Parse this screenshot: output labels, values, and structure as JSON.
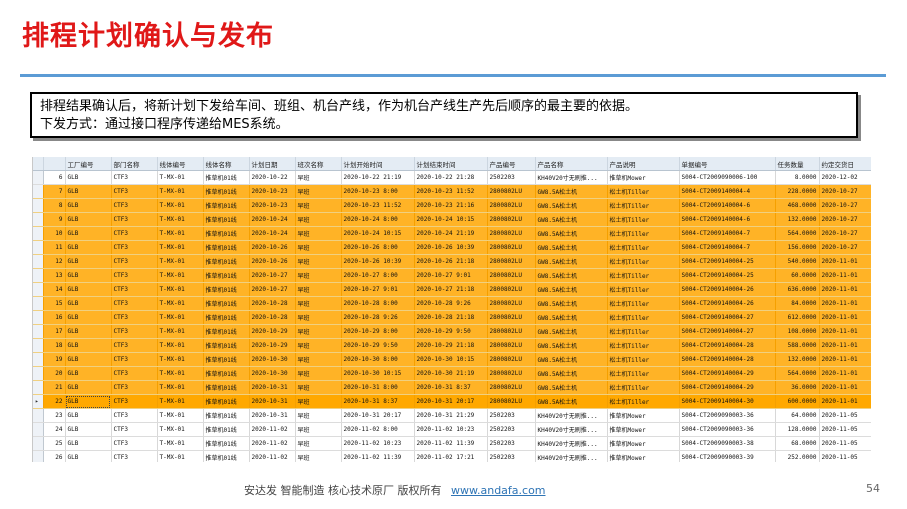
{
  "title": "排程计划确认与发布",
  "note": {
    "line1": "排程结果确认后，将新计划下发给车间、班组、机台产线，作为机台产线生产先后顺序的最主要的依据。",
    "line2": "下发方式：通过接口程序传递给MES系统。"
  },
  "grid": {
    "columns": [
      "",
      "工厂编号",
      "部门名称",
      "线体编号",
      "线体名称",
      "计划日期",
      "班次名称",
      "计划开始时间",
      "计划结束时间",
      "产品编号",
      "产品名称",
      "产品说明",
      "单据编号",
      "任务数量",
      "约定交货日"
    ],
    "current_row_marker": "▸",
    "rows": [
      {
        "n": "6",
        "f": "GLB",
        "d": "CTF3",
        "l": "T-MX-01",
        "ln": "推草机01线",
        "date": "2020-10-22",
        "shift": "早班",
        "start": "2020-10-22 21:19",
        "end": "2020-10-22 21:28",
        "pno": "2502203",
        "pname": "KH40V20寸无刷推...",
        "pdesc": "推草机Mower",
        "doc": "S004-CT2009090006-100",
        "qty": "8.0000",
        "due": "2020-12-02",
        "hl": false
      },
      {
        "n": "7",
        "f": "GLB",
        "d": "CTF3",
        "l": "T-MX-01",
        "ln": "推草机01线",
        "date": "2020-10-23",
        "shift": "早班",
        "start": "2020-10-23 8:00",
        "end": "2020-10-23 11:52",
        "pno": "2800802LU",
        "pname": "GW8.5A松土机",
        "pdesc": "松土机Tiller",
        "doc": "S004-CT2009140004-4",
        "qty": "228.0000",
        "due": "2020-10-27",
        "hl": true
      },
      {
        "n": "8",
        "f": "GLB",
        "d": "CTF3",
        "l": "T-MX-01",
        "ln": "推草机01线",
        "date": "2020-10-23",
        "shift": "早班",
        "start": "2020-10-23 11:52",
        "end": "2020-10-23 21:16",
        "pno": "2800802LU",
        "pname": "GW8.5A松土机",
        "pdesc": "松土机Tiller",
        "doc": "S004-CT2009140004-6",
        "qty": "468.0000",
        "due": "2020-10-27",
        "hl": true
      },
      {
        "n": "9",
        "f": "GLB",
        "d": "CTF3",
        "l": "T-MX-01",
        "ln": "推草机01线",
        "date": "2020-10-24",
        "shift": "早班",
        "start": "2020-10-24 8:00",
        "end": "2020-10-24 10:15",
        "pno": "2800802LU",
        "pname": "GW8.5A松土机",
        "pdesc": "松土机Tiller",
        "doc": "S004-CT2009140004-6",
        "qty": "132.0000",
        "due": "2020-10-27",
        "hl": true
      },
      {
        "n": "10",
        "f": "GLB",
        "d": "CTF3",
        "l": "T-MX-01",
        "ln": "推草机01线",
        "date": "2020-10-24",
        "shift": "早班",
        "start": "2020-10-24 10:15",
        "end": "2020-10-24 21:19",
        "pno": "2800802LU",
        "pname": "GW8.5A松土机",
        "pdesc": "松土机Tiller",
        "doc": "S004-CT2009140004-7",
        "qty": "564.0000",
        "due": "2020-10-27",
        "hl": true
      },
      {
        "n": "11",
        "f": "GLB",
        "d": "CTF3",
        "l": "T-MX-01",
        "ln": "推草机01线",
        "date": "2020-10-26",
        "shift": "早班",
        "start": "2020-10-26 8:00",
        "end": "2020-10-26 10:39",
        "pno": "2800802LU",
        "pname": "GW8.5A松土机",
        "pdesc": "松土机Tiller",
        "doc": "S004-CT2009140004-7",
        "qty": "156.0000",
        "due": "2020-10-27",
        "hl": true
      },
      {
        "n": "12",
        "f": "GLB",
        "d": "CTF3",
        "l": "T-MX-01",
        "ln": "推草机01线",
        "date": "2020-10-26",
        "shift": "早班",
        "start": "2020-10-26 10:39",
        "end": "2020-10-26 21:18",
        "pno": "2800802LU",
        "pname": "GW8.5A松土机",
        "pdesc": "松土机Tiller",
        "doc": "S004-CT2009140004-25",
        "qty": "540.0000",
        "due": "2020-11-01",
        "hl": true
      },
      {
        "n": "13",
        "f": "GLB",
        "d": "CTF3",
        "l": "T-MX-01",
        "ln": "推草机01线",
        "date": "2020-10-27",
        "shift": "早班",
        "start": "2020-10-27 8:00",
        "end": "2020-10-27 9:01",
        "pno": "2800802LU",
        "pname": "GW8.5A松土机",
        "pdesc": "松土机Tiller",
        "doc": "S004-CT2009140004-25",
        "qty": "60.0000",
        "due": "2020-11-01",
        "hl": true
      },
      {
        "n": "14",
        "f": "GLB",
        "d": "CTF3",
        "l": "T-MX-01",
        "ln": "推草机01线",
        "date": "2020-10-27",
        "shift": "早班",
        "start": "2020-10-27 9:01",
        "end": "2020-10-27 21:18",
        "pno": "2800802LU",
        "pname": "GW8.5A松土机",
        "pdesc": "松土机Tiller",
        "doc": "S004-CT2009140004-26",
        "qty": "636.0000",
        "due": "2020-11-01",
        "hl": true
      },
      {
        "n": "15",
        "f": "GLB",
        "d": "CTF3",
        "l": "T-MX-01",
        "ln": "推草机01线",
        "date": "2020-10-28",
        "shift": "早班",
        "start": "2020-10-28 8:00",
        "end": "2020-10-28 9:26",
        "pno": "2800802LU",
        "pname": "GW8.5A松土机",
        "pdesc": "松土机Tiller",
        "doc": "S004-CT2009140004-26",
        "qty": "84.0000",
        "due": "2020-11-01",
        "hl": true
      },
      {
        "n": "16",
        "f": "GLB",
        "d": "CTF3",
        "l": "T-MX-01",
        "ln": "推草机01线",
        "date": "2020-10-28",
        "shift": "早班",
        "start": "2020-10-28 9:26",
        "end": "2020-10-28 21:18",
        "pno": "2800802LU",
        "pname": "GW8.5A松土机",
        "pdesc": "松土机Tiller",
        "doc": "S004-CT2009140004-27",
        "qty": "612.0000",
        "due": "2020-11-01",
        "hl": true
      },
      {
        "n": "17",
        "f": "GLB",
        "d": "CTF3",
        "l": "T-MX-01",
        "ln": "推草机01线",
        "date": "2020-10-29",
        "shift": "早班",
        "start": "2020-10-29 8:00",
        "end": "2020-10-29 9:50",
        "pno": "2800802LU",
        "pname": "GW8.5A松土机",
        "pdesc": "松土机Tiller",
        "doc": "S004-CT2009140004-27",
        "qty": "108.0000",
        "due": "2020-11-01",
        "hl": true
      },
      {
        "n": "18",
        "f": "GLB",
        "d": "CTF3",
        "l": "T-MX-01",
        "ln": "推草机01线",
        "date": "2020-10-29",
        "shift": "早班",
        "start": "2020-10-29 9:50",
        "end": "2020-10-29 21:18",
        "pno": "2800802LU",
        "pname": "GW8.5A松土机",
        "pdesc": "松土机Tiller",
        "doc": "S004-CT2009140004-28",
        "qty": "588.0000",
        "due": "2020-11-01",
        "hl": true
      },
      {
        "n": "19",
        "f": "GLB",
        "d": "CTF3",
        "l": "T-MX-01",
        "ln": "推草机01线",
        "date": "2020-10-30",
        "shift": "早班",
        "start": "2020-10-30 8:00",
        "end": "2020-10-30 10:15",
        "pno": "2800802LU",
        "pname": "GW8.5A松土机",
        "pdesc": "松土机Tiller",
        "doc": "S004-CT2009140004-28",
        "qty": "132.0000",
        "due": "2020-11-01",
        "hl": true
      },
      {
        "n": "20",
        "f": "GLB",
        "d": "CTF3",
        "l": "T-MX-01",
        "ln": "推草机01线",
        "date": "2020-10-30",
        "shift": "早班",
        "start": "2020-10-30 10:15",
        "end": "2020-10-30 21:19",
        "pno": "2800802LU",
        "pname": "GW8.5A松土机",
        "pdesc": "松土机Tiller",
        "doc": "S004-CT2009140004-29",
        "qty": "564.0000",
        "due": "2020-11-01",
        "hl": true
      },
      {
        "n": "21",
        "f": "GLB",
        "d": "CTF3",
        "l": "T-MX-01",
        "ln": "推草机01线",
        "date": "2020-10-31",
        "shift": "早班",
        "start": "2020-10-31 8:00",
        "end": "2020-10-31 8:37",
        "pno": "2800802LU",
        "pname": "GW8.5A松土机",
        "pdesc": "松土机Tiller",
        "doc": "S004-CT2009140004-29",
        "qty": "36.0000",
        "due": "2020-11-01",
        "hl": true
      },
      {
        "n": "22",
        "f": "GLB",
        "d": "CTF3",
        "l": "T-MX-01",
        "ln": "推草机01线",
        "date": "2020-10-31",
        "shift": "早班",
        "start": "2020-10-31 8:37",
        "end": "2020-10-31 20:17",
        "pno": "2800802LU",
        "pname": "GW8.5A松土机",
        "pdesc": "松土机Tiller",
        "doc": "S004-CT2009140004-30",
        "qty": "600.0000",
        "due": "2020-11-01",
        "hl": true,
        "current": true
      },
      {
        "n": "23",
        "f": "GLB",
        "d": "CTF3",
        "l": "T-MX-01",
        "ln": "推草机01线",
        "date": "2020-10-31",
        "shift": "早班",
        "start": "2020-10-31 20:17",
        "end": "2020-10-31 21:29",
        "pno": "2502203",
        "pname": "KH40V20寸无刷推...",
        "pdesc": "推草机Mower",
        "doc": "S004-CT2009090003-36",
        "qty": "64.0000",
        "due": "2020-11-05",
        "hl": false
      },
      {
        "n": "24",
        "f": "GLB",
        "d": "CTF3",
        "l": "T-MX-01",
        "ln": "推草机01线",
        "date": "2020-11-02",
        "shift": "早班",
        "start": "2020-11-02 8:00",
        "end": "2020-11-02 10:23",
        "pno": "2502203",
        "pname": "KH40V20寸无刷推...",
        "pdesc": "推草机Mower",
        "doc": "S004-CT2009090003-36",
        "qty": "128.0000",
        "due": "2020-11-05",
        "hl": false
      },
      {
        "n": "25",
        "f": "GLB",
        "d": "CTF3",
        "l": "T-MX-01",
        "ln": "推草机01线",
        "date": "2020-11-02",
        "shift": "早班",
        "start": "2020-11-02 10:23",
        "end": "2020-11-02 11:39",
        "pno": "2502203",
        "pname": "KH40V20寸无刷推...",
        "pdesc": "推草机Mower",
        "doc": "S004-CT2009090003-38",
        "qty": "68.0000",
        "due": "2020-11-05",
        "hl": false
      },
      {
        "n": "26",
        "f": "GLB",
        "d": "CTF3",
        "l": "T-MX-01",
        "ln": "推草机01线",
        "date": "2020-11-02",
        "shift": "早班",
        "start": "2020-11-02 11:39",
        "end": "2020-11-02 17:21",
        "pno": "2502203",
        "pname": "KH40V20寸无刷推...",
        "pdesc": "推草机Mower",
        "doc": "S004-CT2009090003-39",
        "qty": "252.0000",
        "due": "2020-11-05",
        "hl": false
      }
    ]
  },
  "footer": {
    "text": "安达发   智能制造 核心技术原厂   版权所有",
    "link": "www.andafa.com",
    "page": "54"
  }
}
